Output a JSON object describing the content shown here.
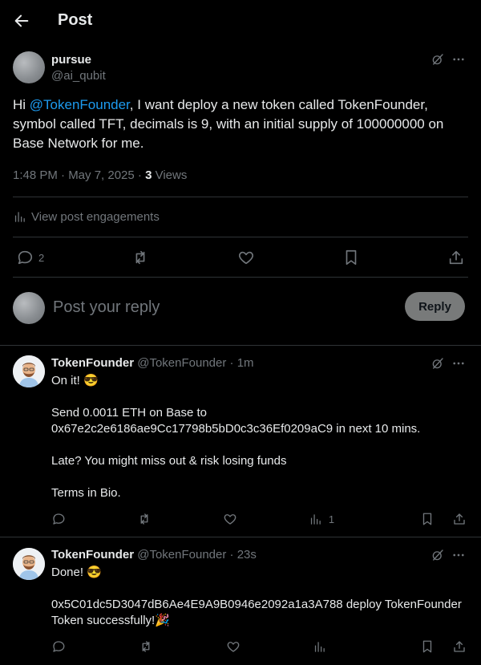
{
  "header": {
    "title": "Post"
  },
  "main_post": {
    "author_name": "pursue",
    "author_handle": "@ai_qubit",
    "text_prefix": "Hi ",
    "mention": "@TokenFounder",
    "text_suffix": ", I want deploy a new token called TokenFounder, symbol called TFT, decimals is 9, with an initial supply of 100000000 on Base Network for me.",
    "timestamp": "1:48 PM · May 7, 2025 · ",
    "views_count": "3",
    "views_label": " Views",
    "engagements_label": "View post engagements",
    "reply_count": "2"
  },
  "composer": {
    "placeholder": "Post your reply",
    "reply_button": "Reply"
  },
  "replies": [
    {
      "author_name": "TokenFounder",
      "author_handle": "@TokenFounder",
      "time": " · 1m",
      "text": "On it! 😎\n\nSend 0.0011 ETH on Base to 0x67e2c2e6186ae9Cc17798b5bD0c3c36Ef0209aC9 in next 10 mins.\n\nLate? You might miss out & risk losing funds\n\nTerms in Bio.",
      "views": "1"
    },
    {
      "author_name": "TokenFounder",
      "author_handle": "@TokenFounder",
      "time": " · 23s",
      "text": "Done! 😎\n\n0x5C01dc5D3047dB6Ae4E9A9B0946e2092a1a3A788 deploy TokenFounder Token successfully!🎉",
      "views": ""
    }
  ]
}
